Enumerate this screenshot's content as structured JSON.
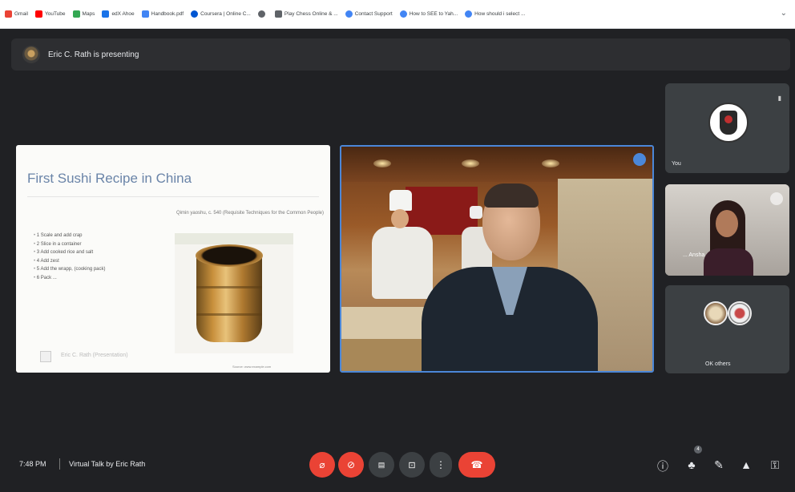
{
  "bookmarks": [
    {
      "label": "Gmail",
      "color": "#ea4335"
    },
    {
      "label": "YouTube",
      "color": "#ff0000"
    },
    {
      "label": "Maps",
      "color": "#34a853"
    },
    {
      "label": "edX Ahoe",
      "color": "#1a73e8"
    },
    {
      "label": "Handbook.pdf",
      "color": "#4285f4"
    },
    {
      "label": "Coursera | Online C...",
      "color": "#0056d2"
    },
    {
      "label": "",
      "color": "#5f6368"
    },
    {
      "label": "Play Chess Online & ...",
      "color": "#5f6368"
    },
    {
      "label": "Contact Support",
      "color": "#4285f4"
    },
    {
      "label": "How to SEE to Yah...",
      "color": "#4285f4"
    },
    {
      "label": "How should i select ...",
      "color": "#4285f4"
    }
  ],
  "banner": {
    "text": "Eric C. Rath is presenting"
  },
  "slide": {
    "title": "First Sushi Recipe in China",
    "subtitle": "Qimin yaoshu, c. 540 (Requisite Techniques for the Common People)",
    "bullets": [
      "1 Scale and add crap",
      "2 Slice in a container",
      "3 Add cooked rice and salt",
      "4 Add zest",
      "5 Add the wrapp, (cooking pack)",
      "6 Pack ..."
    ],
    "footer": "Eric C. Rath (Presentation)",
    "credit": "Source: www.example.com"
  },
  "participants": [
    {
      "name": "You"
    },
    {
      "name": "... Ansha"
    },
    {
      "name": "OK others"
    }
  ],
  "bottombar": {
    "time": "7:48 PM",
    "meeting_title": "Virtual Talk by Eric Rath",
    "controls": {
      "mic_icon": "mic-off-icon",
      "cam_icon": "camera-off-icon",
      "captions_icon": "captions-icon",
      "present_icon": "present-icon",
      "more_icon": "more-icon",
      "end_icon": "end-call-icon"
    },
    "people_badge": "4",
    "accent_red": "#ea4335"
  }
}
